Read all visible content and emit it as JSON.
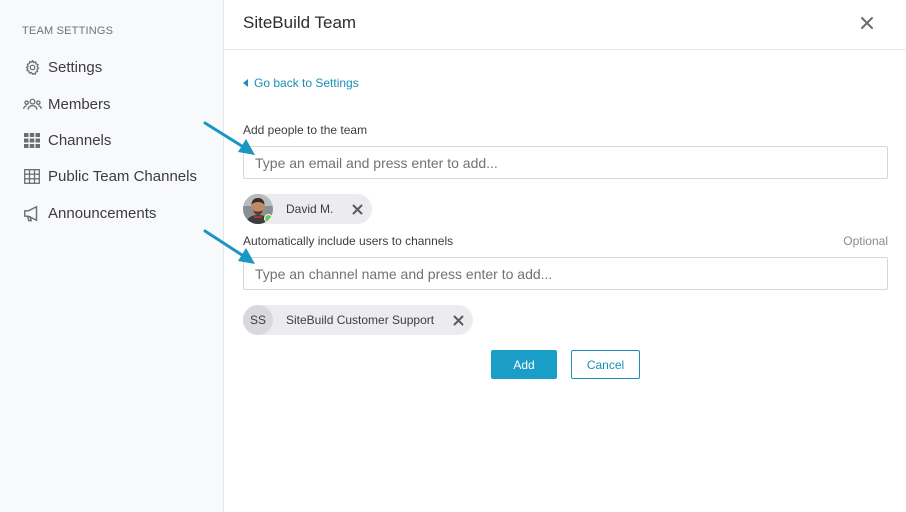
{
  "sidebar": {
    "heading": "TEAM SETTINGS",
    "items": [
      {
        "label": "Settings",
        "icon": "gear-icon"
      },
      {
        "label": "Members",
        "icon": "members-icon"
      },
      {
        "label": "Channels",
        "icon": "grid-icon"
      },
      {
        "label": "Public Team Channels",
        "icon": "table-icon"
      },
      {
        "label": "Announcements",
        "icon": "megaphone-icon"
      }
    ]
  },
  "header": {
    "title": "SiteBuild Team",
    "close_icon": "close-icon"
  },
  "form": {
    "back_link": "Go back to Settings",
    "people_label": "Add people to the team",
    "people_placeholder": "Type an email and press enter to add...",
    "people_chips": [
      {
        "label": "David M.",
        "status": "online"
      }
    ],
    "channels_label": "Automatically include users to channels",
    "optional_label": "Optional",
    "channels_placeholder": "Type an channel name and press enter to add...",
    "channel_chips": [
      {
        "initials": "SS",
        "label": "SiteBuild Customer Support"
      }
    ],
    "add_label": "Add",
    "cancel_label": "Cancel"
  },
  "colors": {
    "accent": "#1a9dc6",
    "link": "#1a8fb9",
    "annotation_arrow": "#1a96c2",
    "online": "#6bc950"
  }
}
